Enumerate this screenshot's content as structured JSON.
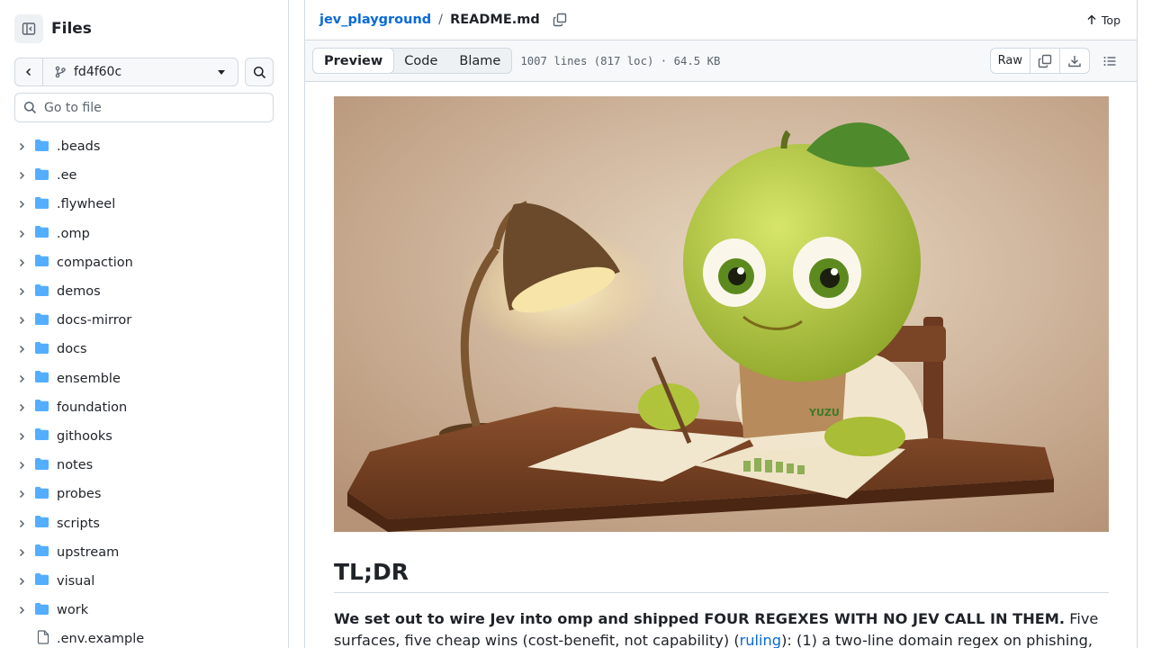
{
  "sidebar": {
    "title": "Files",
    "branch": "fd4f60c",
    "goto_placeholder": "Go to file",
    "items": [
      {
        "label": ".beads",
        "type": "folder"
      },
      {
        "label": ".ee",
        "type": "folder"
      },
      {
        "label": ".flywheel",
        "type": "folder"
      },
      {
        "label": ".omp",
        "type": "folder"
      },
      {
        "label": "compaction",
        "type": "folder"
      },
      {
        "label": "demos",
        "type": "folder"
      },
      {
        "label": "docs-mirror",
        "type": "folder"
      },
      {
        "label": "docs",
        "type": "folder"
      },
      {
        "label": "ensemble",
        "type": "folder"
      },
      {
        "label": "foundation",
        "type": "folder"
      },
      {
        "label": "githooks",
        "type": "folder"
      },
      {
        "label": "notes",
        "type": "folder"
      },
      {
        "label": "probes",
        "type": "folder"
      },
      {
        "label": "scripts",
        "type": "folder"
      },
      {
        "label": "upstream",
        "type": "folder"
      },
      {
        "label": "visual",
        "type": "folder"
      },
      {
        "label": "work",
        "type": "folder"
      },
      {
        "label": ".env.example",
        "type": "file"
      }
    ]
  },
  "header": {
    "repo": "jev_playground",
    "separator": "/",
    "file": "README.md",
    "top_label": "Top"
  },
  "toolbar": {
    "tabs": [
      {
        "label": "Preview",
        "active": true
      },
      {
        "label": "Code",
        "active": false
      },
      {
        "label": "Blame",
        "active": false
      }
    ],
    "meta": "1007 lines (817 loc) · 64.5 KB",
    "raw_label": "Raw"
  },
  "readme": {
    "hero_badge": "YUZU",
    "heading": "TL;DR",
    "bold_lead": "We set out to wire Jev into omp and shipped FOUR REGEXES WITH NO JEV CALL IN THEM.",
    "text_1": " Five surfaces, five cheap wins (cost-benefit, not capability) (",
    "link": "ruling",
    "text_2": "): (1) a two-line domain regex on phishing,"
  },
  "colors": {
    "accent": "#0969da",
    "border": "#d1d9e0",
    "folder": "#54aeff",
    "muted": "#59636e"
  }
}
